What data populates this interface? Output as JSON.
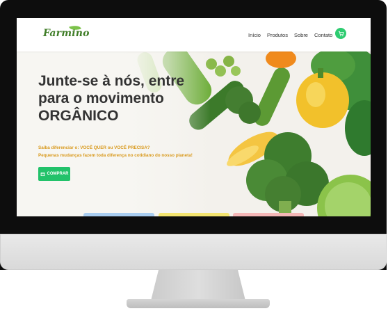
{
  "brand": {
    "logo_text": "Farmino"
  },
  "nav": {
    "items": [
      {
        "label": "Início"
      },
      {
        "label": "Produtos"
      },
      {
        "label": "Sobre"
      },
      {
        "label": "Contato"
      }
    ],
    "cart_icon": "cart-icon"
  },
  "hero": {
    "title_line1": "Junte-se à nós, entre",
    "title_line2": "para o movimento",
    "title_line3": "ORGÂNICO",
    "subtitle_line1": "Saiba diferenciar o: VOCÊ QUER ou VOCÊ PRECISA?",
    "subtitle_line2": "Pequenas mudanças fazem toda diferença no cotidiano do nosso planeta!",
    "button_label": "COMPRAR",
    "button_icon": "cart-icon"
  },
  "colors": {
    "accent_green": "#22c26a",
    "subtitle_orange": "#d99a1e",
    "card_blue": "#a9cdf0",
    "card_yellow": "#f3e46f",
    "card_pink": "#f4b6b6"
  }
}
